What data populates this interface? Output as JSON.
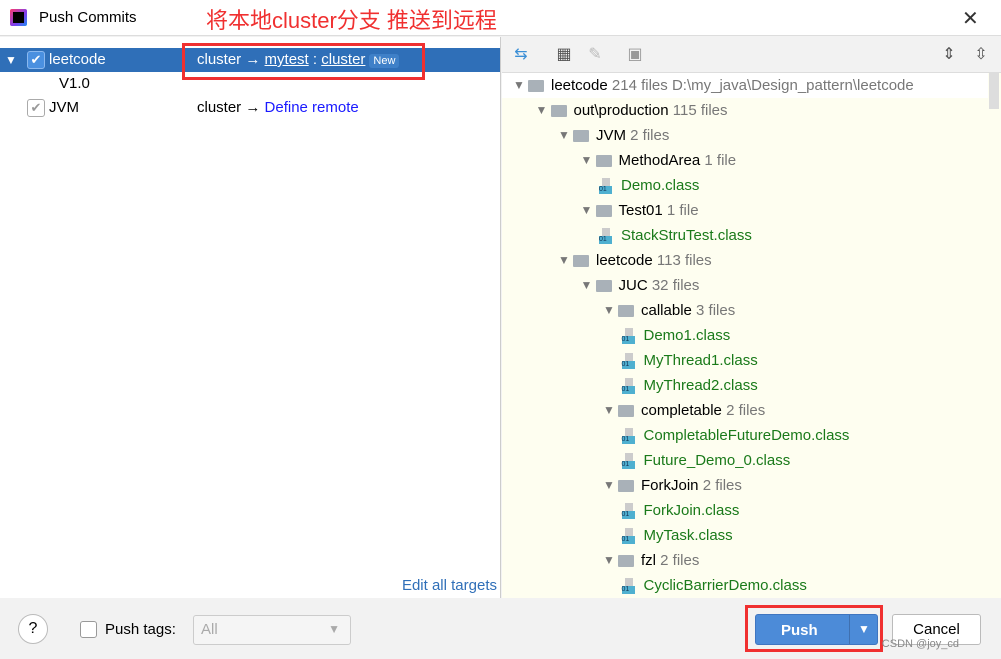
{
  "window": {
    "title": "Push Commits",
    "annotation": "将本地cluster分支 推送到远程",
    "close": "✕"
  },
  "left": {
    "repos": [
      {
        "name": "leetcode",
        "checked": true,
        "source": "cluster",
        "arrow": "→",
        "remote": "mytest",
        "sep": ":",
        "target": "cluster",
        "badge": "New",
        "tag": "V1.0"
      },
      {
        "name": "JVM",
        "checked": true,
        "source": "cluster",
        "arrow": "→",
        "define": "Define remote"
      }
    ],
    "edit_all_targets": "Edit all targets"
  },
  "tree": [
    {
      "name": "leetcode",
      "count": "214 files",
      "path": "D:\\my_java\\Design_pattern\\leetcode",
      "level": 0,
      "type": "module"
    },
    {
      "name": "out\\production",
      "count": "115 files",
      "level": 1,
      "type": "folder"
    },
    {
      "name": "JVM",
      "count": "2 files",
      "level": 2,
      "type": "folder"
    },
    {
      "name": "MethodArea",
      "count": "1 file",
      "level": 3,
      "type": "folder"
    },
    {
      "name": "Demo.class",
      "level": 4,
      "type": "file"
    },
    {
      "name": "Test01",
      "count": "1 file",
      "level": 3,
      "type": "folder"
    },
    {
      "name": "StackStruTest.class",
      "level": 4,
      "type": "file"
    },
    {
      "name": "leetcode",
      "count": "113 files",
      "level": 2,
      "type": "folder"
    },
    {
      "name": "JUC",
      "count": "32 files",
      "level": 3,
      "type": "folder"
    },
    {
      "name": "callable",
      "count": "3 files",
      "level": 4,
      "type": "folder"
    },
    {
      "name": "Demo1.class",
      "level": 5,
      "type": "file"
    },
    {
      "name": "MyThread1.class",
      "level": 5,
      "type": "file"
    },
    {
      "name": "MyThread2.class",
      "level": 5,
      "type": "file"
    },
    {
      "name": "completable",
      "count": "2 files",
      "level": 4,
      "type": "folder"
    },
    {
      "name": "CompletableFutureDemo.class",
      "level": 5,
      "type": "file"
    },
    {
      "name": "Future_Demo_0.class",
      "level": 5,
      "type": "file"
    },
    {
      "name": "ForkJoin",
      "count": "2 files",
      "level": 4,
      "type": "folder"
    },
    {
      "name": "ForkJoin.class",
      "level": 5,
      "type": "file"
    },
    {
      "name": "MyTask.class",
      "level": 5,
      "type": "file"
    },
    {
      "name": "fzl",
      "count": "2 files",
      "level": 4,
      "type": "folder"
    },
    {
      "name": "CyclicBarrierDemo.class",
      "level": 5,
      "type": "file"
    }
  ],
  "bottom": {
    "help": "?",
    "push_tags_label": "Push tags:",
    "push_tags_checked": false,
    "tags_value": "All",
    "push": "Push",
    "cancel": "Cancel",
    "watermark": "CSDN @joy_cd"
  }
}
